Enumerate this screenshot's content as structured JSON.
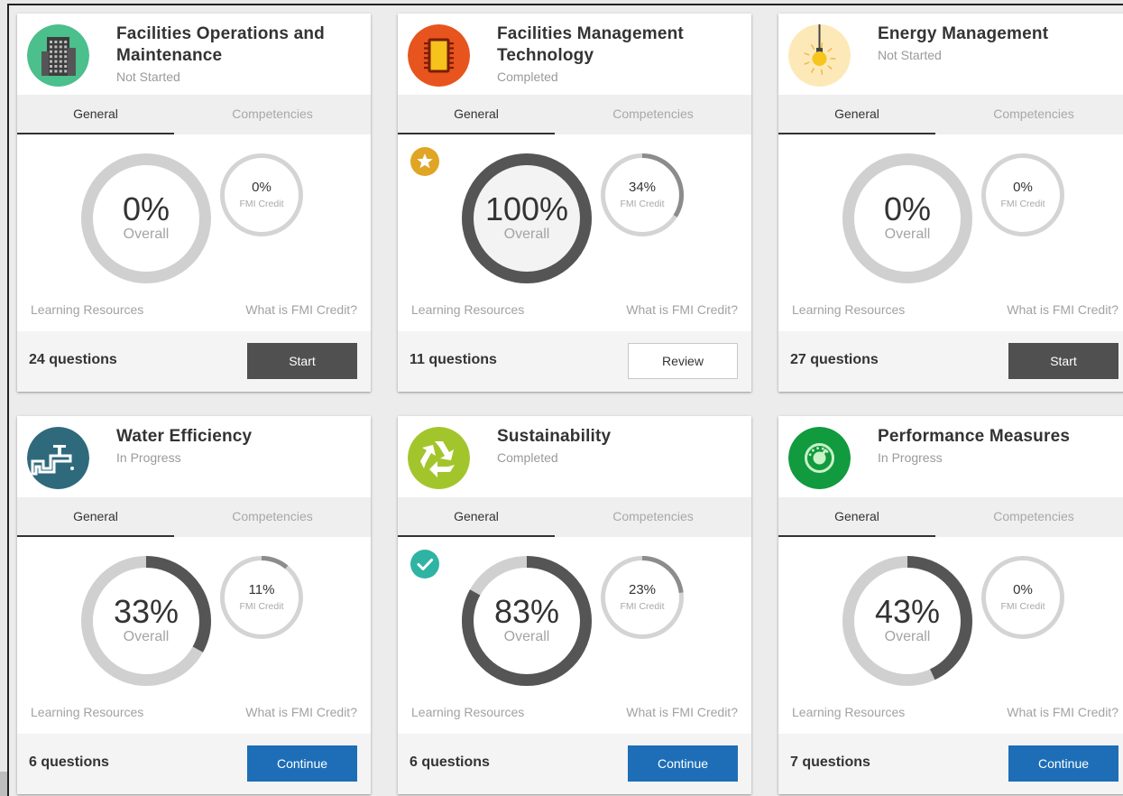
{
  "colors": {
    "accent_blue": "#1d6eb7",
    "dark_button": "#505050",
    "ring_track": "#d0d0d0",
    "ring_fill": "#555555",
    "star_badge": "#e0a524",
    "check_badge": "#2fb4a4"
  },
  "cards": [
    {
      "title": "Facilities Operations and Maintenance",
      "status": "Not Started",
      "icon": "building-icon",
      "tabs": [
        "General",
        "Competencies"
      ],
      "overall_pct": "0%",
      "overall_value": 0,
      "overall_label": "Overall",
      "credit_pct": "0%",
      "credit_value": 0,
      "credit_label": "FMI Credit",
      "badge": null,
      "link_left": "Learning Resources",
      "link_right": "What is FMI Credit?",
      "questions": "24 questions",
      "button": "Start",
      "button_style": "dark"
    },
    {
      "title": "Facilities Management Technology",
      "status": "Completed",
      "icon": "microchip-icon",
      "tabs": [
        "General",
        "Competencies"
      ],
      "overall_pct": "100%",
      "overall_value": 100,
      "overall_label": "Overall",
      "credit_pct": "34%",
      "credit_value": 34,
      "credit_label": "FMI Credit",
      "badge": "star-badge-icon",
      "link_left": "Learning Resources",
      "link_right": "What is FMI Credit?",
      "questions": "11 questions",
      "button": "Review",
      "button_style": "light"
    },
    {
      "title": "Energy Management",
      "status": "Not Started",
      "icon": "light-bulb-icon",
      "tabs": [
        "General",
        "Competencies"
      ],
      "overall_pct": "0%",
      "overall_value": 0,
      "overall_label": "Overall",
      "credit_pct": "0%",
      "credit_value": 0,
      "credit_label": "FMI Credit",
      "badge": null,
      "link_left": "Learning Resources",
      "link_right": "What is FMI Credit?",
      "questions": "27 questions",
      "button": "Start",
      "button_style": "dark"
    },
    {
      "title": "Water Efficiency",
      "status": "In Progress",
      "icon": "faucet-icon",
      "tabs": [
        "General",
        "Competencies"
      ],
      "overall_pct": "33%",
      "overall_value": 33,
      "overall_label": "Overall",
      "credit_pct": "11%",
      "credit_value": 11,
      "credit_label": "FMI Credit",
      "badge": null,
      "link_left": "Learning Resources",
      "link_right": "What is FMI Credit?",
      "questions": "6 questions",
      "button": "Continue",
      "button_style": "blue"
    },
    {
      "title": "Sustainability",
      "status": "Completed",
      "icon": "recycle-icon",
      "tabs": [
        "General",
        "Competencies"
      ],
      "overall_pct": "83%",
      "overall_value": 83,
      "overall_label": "Overall",
      "credit_pct": "23%",
      "credit_value": 23,
      "credit_label": "FMI Credit",
      "badge": "checkmark-badge-icon",
      "link_left": "Learning Resources",
      "link_right": "What is FMI Credit?",
      "questions": "6 questions",
      "button": "Continue",
      "button_style": "blue"
    },
    {
      "title": "Performance Measures",
      "status": "In Progress",
      "icon": "gauge-icon",
      "tabs": [
        "General",
        "Competencies"
      ],
      "overall_pct": "43%",
      "overall_value": 43,
      "overall_label": "Overall",
      "credit_pct": "0%",
      "credit_value": 0,
      "credit_label": "FMI Credit",
      "badge": null,
      "link_left": "Learning Resources",
      "link_right": "What is FMI Credit?",
      "questions": "7 questions",
      "button": "Continue",
      "button_style": "blue"
    }
  ]
}
